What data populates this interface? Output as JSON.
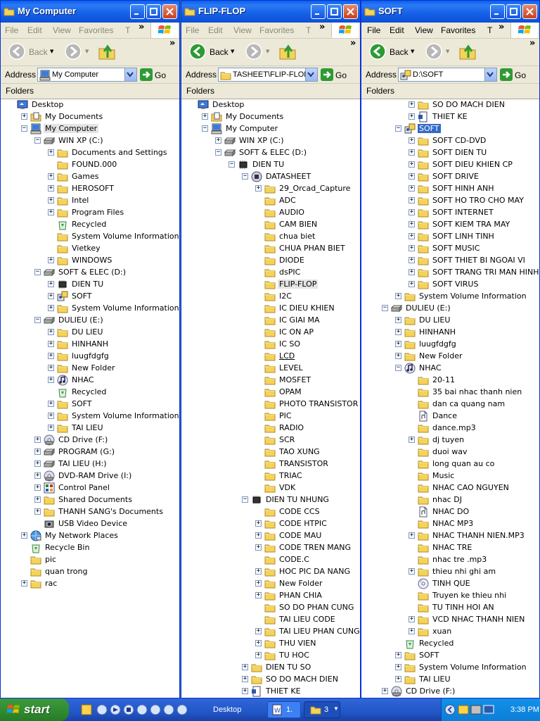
{
  "colors": {
    "title_blue": "#0a5fea",
    "selection": "#316ac5",
    "folder_yellow": "#f4d35a",
    "start_green": "#2f8a2f"
  },
  "menu": {
    "file": "File",
    "edit": "Edit",
    "view": "View",
    "favorites": "Favorites",
    "tools": "T"
  },
  "toolbar": {
    "back": "Back"
  },
  "address_label": "Address",
  "go_label": "Go",
  "folders_label": "Folders",
  "windows": [
    {
      "title": "My Computer",
      "address": "My Computer",
      "address_icon": "computer-icon",
      "menu_dim": true,
      "tree": [
        {
          "i": 0,
          "e": "",
          "ic": "desktop",
          "t": "Desktop"
        },
        {
          "i": 1,
          "e": "+",
          "ic": "mydocs",
          "t": "My Documents"
        },
        {
          "i": 1,
          "e": "-",
          "ic": "computer",
          "t": "My Computer",
          "s": "hl"
        },
        {
          "i": 2,
          "e": "-",
          "ic": "drive",
          "t": "WIN XP (C:)"
        },
        {
          "i": 3,
          "e": "+",
          "ic": "folder",
          "t": "Documents and Settings"
        },
        {
          "i": 3,
          "e": "",
          "ic": "folder",
          "t": "FOUND.000"
        },
        {
          "i": 3,
          "e": "+",
          "ic": "folder",
          "t": "Games"
        },
        {
          "i": 3,
          "e": "+",
          "ic": "folder",
          "t": "HEROSOFT"
        },
        {
          "i": 3,
          "e": "+",
          "ic": "folder",
          "t": "Intel"
        },
        {
          "i": 3,
          "e": "+",
          "ic": "folder",
          "t": "Program Files"
        },
        {
          "i": 3,
          "e": "",
          "ic": "recycle",
          "t": "Recycled"
        },
        {
          "i": 3,
          "e": "",
          "ic": "folder",
          "t": "System Volume Information"
        },
        {
          "i": 3,
          "e": "",
          "ic": "folder",
          "t": "Vietkey"
        },
        {
          "i": 3,
          "e": "+",
          "ic": "folder",
          "t": "WINDOWS"
        },
        {
          "i": 2,
          "e": "-",
          "ic": "drive",
          "t": "SOFT & ELEC (D:)"
        },
        {
          "i": 3,
          "e": "+",
          "ic": "chip",
          "t": "DIEN TU"
        },
        {
          "i": 3,
          "e": "+",
          "ic": "soft",
          "t": "SOFT"
        },
        {
          "i": 3,
          "e": "+",
          "ic": "folder",
          "t": "System Volume Information"
        },
        {
          "i": 2,
          "e": "-",
          "ic": "drive",
          "t": "DULIEU (E:)"
        },
        {
          "i": 3,
          "e": "+",
          "ic": "folder",
          "t": "DU LIEU"
        },
        {
          "i": 3,
          "e": "+",
          "ic": "folder",
          "t": "HINHANH"
        },
        {
          "i": 3,
          "e": "+",
          "ic": "folder",
          "t": "luugfdgfg"
        },
        {
          "i": 3,
          "e": "+",
          "ic": "folder",
          "t": "New Folder"
        },
        {
          "i": 3,
          "e": "+",
          "ic": "music",
          "t": "NHAC"
        },
        {
          "i": 3,
          "e": "",
          "ic": "recycle",
          "t": "Recycled"
        },
        {
          "i": 3,
          "e": "+",
          "ic": "folder",
          "t": "SOFT"
        },
        {
          "i": 3,
          "e": "+",
          "ic": "folder",
          "t": "System Volume Information"
        },
        {
          "i": 3,
          "e": "+",
          "ic": "folder",
          "t": "TAI LIEU"
        },
        {
          "i": 2,
          "e": "+",
          "ic": "cd",
          "t": "CD Drive (F:)"
        },
        {
          "i": 2,
          "e": "+",
          "ic": "drive",
          "t": "PROGRAM (G:)"
        },
        {
          "i": 2,
          "e": "+",
          "ic": "drive",
          "t": "TAI LIEU (H:)"
        },
        {
          "i": 2,
          "e": "+",
          "ic": "cd",
          "t": "DVD-RAM Drive (I:)"
        },
        {
          "i": 2,
          "e": "+",
          "ic": "control",
          "t": "Control Panel"
        },
        {
          "i": 2,
          "e": "+",
          "ic": "folder",
          "t": "Shared Documents"
        },
        {
          "i": 2,
          "e": "+",
          "ic": "folder",
          "t": "THANH SANG's Documents"
        },
        {
          "i": 2,
          "e": "",
          "ic": "camera",
          "t": "USB Video Device"
        },
        {
          "i": 1,
          "e": "+",
          "ic": "network",
          "t": "My Network Places"
        },
        {
          "i": 1,
          "e": "",
          "ic": "recycle",
          "t": "Recycle Bin"
        },
        {
          "i": 1,
          "e": "",
          "ic": "folder",
          "t": "pic"
        },
        {
          "i": 1,
          "e": "",
          "ic": "folder",
          "t": "quan trong"
        },
        {
          "i": 1,
          "e": "+",
          "ic": "folder",
          "t": "rac"
        }
      ]
    },
    {
      "title": "FLIP-FLOP",
      "address": "TASHEET\\FLIP-FLOP",
      "address_icon": "folder-icon",
      "menu_dim": true,
      "tree": [
        {
          "i": 0,
          "e": "",
          "ic": "desktop",
          "t": "Desktop"
        },
        {
          "i": 1,
          "e": "+",
          "ic": "mydocs",
          "t": "My Documents"
        },
        {
          "i": 1,
          "e": "-",
          "ic": "computer",
          "t": "My Computer"
        },
        {
          "i": 2,
          "e": "+",
          "ic": "drive",
          "t": "WIN XP (C:)"
        },
        {
          "i": 2,
          "e": "-",
          "ic": "drive",
          "t": "SOFT & ELEC (D:)"
        },
        {
          "i": 3,
          "e": "-",
          "ic": "chip",
          "t": "DIEN TU"
        },
        {
          "i": 4,
          "e": "-",
          "ic": "chip2",
          "t": "DATASHEET"
        },
        {
          "i": 5,
          "e": "+",
          "ic": "folder",
          "t": "29_Orcad_Capture"
        },
        {
          "i": 5,
          "e": "",
          "ic": "folder",
          "t": "ADC"
        },
        {
          "i": 5,
          "e": "",
          "ic": "folder",
          "t": "AUDIO"
        },
        {
          "i": 5,
          "e": "",
          "ic": "folder",
          "t": "CAM BIEN"
        },
        {
          "i": 5,
          "e": "",
          "ic": "folder",
          "t": "chua biet"
        },
        {
          "i": 5,
          "e": "",
          "ic": "folder",
          "t": "CHUA PHAN BIET"
        },
        {
          "i": 5,
          "e": "",
          "ic": "folder",
          "t": "DIODE"
        },
        {
          "i": 5,
          "e": "",
          "ic": "folder",
          "t": "dsPIC"
        },
        {
          "i": 5,
          "e": "",
          "ic": "folder",
          "t": "FLIP-FLOP",
          "s": "hl"
        },
        {
          "i": 5,
          "e": "",
          "ic": "folder",
          "t": "I2C"
        },
        {
          "i": 5,
          "e": "",
          "ic": "folder",
          "t": "IC DIEU KHIEN"
        },
        {
          "i": 5,
          "e": "",
          "ic": "folder",
          "t": "IC GIAI MA"
        },
        {
          "i": 5,
          "e": "",
          "ic": "folder",
          "t": "IC ON AP"
        },
        {
          "i": 5,
          "e": "",
          "ic": "folder",
          "t": "IC SO"
        },
        {
          "i": 5,
          "e": "",
          "ic": "folder",
          "t": "LCD",
          "s": "ul"
        },
        {
          "i": 5,
          "e": "",
          "ic": "folder",
          "t": "LEVEL"
        },
        {
          "i": 5,
          "e": "",
          "ic": "folder",
          "t": "MOSFET"
        },
        {
          "i": 5,
          "e": "",
          "ic": "folder",
          "t": "OPAM"
        },
        {
          "i": 5,
          "e": "",
          "ic": "folder",
          "t": "PHOTO TRANSISTOR"
        },
        {
          "i": 5,
          "e": "",
          "ic": "folder",
          "t": "PIC"
        },
        {
          "i": 5,
          "e": "",
          "ic": "folder",
          "t": "RADIO"
        },
        {
          "i": 5,
          "e": "",
          "ic": "folder",
          "t": "SCR"
        },
        {
          "i": 5,
          "e": "",
          "ic": "folder",
          "t": "TAO XUNG"
        },
        {
          "i": 5,
          "e": "",
          "ic": "folder",
          "t": "TRANSISTOR"
        },
        {
          "i": 5,
          "e": "",
          "ic": "folder",
          "t": "TRIAC"
        },
        {
          "i": 5,
          "e": "",
          "ic": "folder",
          "t": "VDK"
        },
        {
          "i": 4,
          "e": "-",
          "ic": "chip",
          "t": "DIEN TU NHUNG"
        },
        {
          "i": 5,
          "e": "",
          "ic": "folder",
          "t": "CODE CCS"
        },
        {
          "i": 5,
          "e": "+",
          "ic": "folder",
          "t": "CODE HTPIC"
        },
        {
          "i": 5,
          "e": "+",
          "ic": "folder",
          "t": "CODE MAU"
        },
        {
          "i": 5,
          "e": "+",
          "ic": "folder",
          "t": "CODE TREN MANG"
        },
        {
          "i": 5,
          "e": "",
          "ic": "folder",
          "t": "CODE.C"
        },
        {
          "i": 5,
          "e": "+",
          "ic": "folder",
          "t": "HOC PIC DA NANG"
        },
        {
          "i": 5,
          "e": "+",
          "ic": "folder",
          "t": "New Folder"
        },
        {
          "i": 5,
          "e": "+",
          "ic": "folder",
          "t": "PHAN CHIA"
        },
        {
          "i": 5,
          "e": "",
          "ic": "folder",
          "t": "SO DO PHAN CUNG"
        },
        {
          "i": 5,
          "e": "",
          "ic": "folder",
          "t": "TAI LIEU CODE"
        },
        {
          "i": 5,
          "e": "+",
          "ic": "folder",
          "t": "TAI LIEU PHAN CUNG"
        },
        {
          "i": 5,
          "e": "+",
          "ic": "folder",
          "t": "THU VIEN"
        },
        {
          "i": 5,
          "e": "+",
          "ic": "folder",
          "t": "TU HOC"
        },
        {
          "i": 4,
          "e": "+",
          "ic": "folder",
          "t": "DIEN TU SO"
        },
        {
          "i": 4,
          "e": "+",
          "ic": "folder",
          "t": "SO DO MACH DIEN"
        },
        {
          "i": 4,
          "e": "+",
          "ic": "doc",
          "t": "THIET KE"
        }
      ]
    },
    {
      "title": "SOFT",
      "address": "D:\\SOFT",
      "address_icon": "soft-icon",
      "menu_dim": false,
      "tree": [
        {
          "i": 3,
          "e": "+",
          "ic": "folder",
          "t": "SO DO MACH DIEN"
        },
        {
          "i": 3,
          "e": "+",
          "ic": "doc",
          "t": "THIET KE"
        },
        {
          "i": 2,
          "e": "-",
          "ic": "soft",
          "t": "SOFT",
          "s": "sel"
        },
        {
          "i": 3,
          "e": "+",
          "ic": "folder",
          "t": "SOFT CD-DVD"
        },
        {
          "i": 3,
          "e": "+",
          "ic": "folder",
          "t": "SOFT DIEN TU"
        },
        {
          "i": 3,
          "e": "+",
          "ic": "folder",
          "t": "SOFT DIEU KHIEN CP"
        },
        {
          "i": 3,
          "e": "+",
          "ic": "folder",
          "t": "SOFT DRIVE"
        },
        {
          "i": 3,
          "e": "+",
          "ic": "folder",
          "t": "SOFT HINH ANH"
        },
        {
          "i": 3,
          "e": "+",
          "ic": "folder",
          "t": "SOFT HO TRO CHO MAY"
        },
        {
          "i": 3,
          "e": "+",
          "ic": "folder",
          "t": "SOFT INTERNET"
        },
        {
          "i": 3,
          "e": "+",
          "ic": "folder",
          "t": "SOFT KIEM TRA MAY"
        },
        {
          "i": 3,
          "e": "+",
          "ic": "folder",
          "t": "SOFT LINH TINH"
        },
        {
          "i": 3,
          "e": "+",
          "ic": "folder",
          "t": "SOFT MUSIC"
        },
        {
          "i": 3,
          "e": "+",
          "ic": "folder",
          "t": "SOFT THIET BI NGOAI VI"
        },
        {
          "i": 3,
          "e": "+",
          "ic": "folder",
          "t": "SOFT TRANG TRI MAN HINH"
        },
        {
          "i": 3,
          "e": "+",
          "ic": "folder",
          "t": "SOFT VIRUS"
        },
        {
          "i": 2,
          "e": "+",
          "ic": "folder",
          "t": "System Volume Information"
        },
        {
          "i": 1,
          "e": "-",
          "ic": "drive",
          "t": "DULIEU (E:)"
        },
        {
          "i": 2,
          "e": "+",
          "ic": "folder",
          "t": "DU LIEU"
        },
        {
          "i": 2,
          "e": "+",
          "ic": "folder",
          "t": "HINHANH"
        },
        {
          "i": 2,
          "e": "+",
          "ic": "folder",
          "t": "luugfdgfg"
        },
        {
          "i": 2,
          "e": "+",
          "ic": "folder",
          "t": "New Folder"
        },
        {
          "i": 2,
          "e": "-",
          "ic": "music",
          "t": "NHAC"
        },
        {
          "i": 3,
          "e": "",
          "ic": "folder",
          "t": "20-11"
        },
        {
          "i": 3,
          "e": "",
          "ic": "folder",
          "t": "35 bai nhac thanh nien"
        },
        {
          "i": 3,
          "e": "",
          "ic": "folder",
          "t": "dan ca quang nam"
        },
        {
          "i": 3,
          "e": "",
          "ic": "file",
          "t": "Dance"
        },
        {
          "i": 3,
          "e": "",
          "ic": "folder",
          "t": "dance.mp3"
        },
        {
          "i": 3,
          "e": "+",
          "ic": "folder",
          "t": "dj tuyen"
        },
        {
          "i": 3,
          "e": "",
          "ic": "folder",
          "t": "duoi wav"
        },
        {
          "i": 3,
          "e": "",
          "ic": "folder",
          "t": "long quan au co"
        },
        {
          "i": 3,
          "e": "",
          "ic": "folder",
          "t": "Music"
        },
        {
          "i": 3,
          "e": "",
          "ic": "folder",
          "t": "NHAC CAO NGUYEN"
        },
        {
          "i": 3,
          "e": "",
          "ic": "folder",
          "t": "nhac DJ"
        },
        {
          "i": 3,
          "e": "",
          "ic": "file",
          "t": "NHAC DO"
        },
        {
          "i": 3,
          "e": "",
          "ic": "folder",
          "t": "NHAC MP3"
        },
        {
          "i": 3,
          "e": "+",
          "ic": "folder",
          "t": "NHAC THANH NIEN.MP3"
        },
        {
          "i": 3,
          "e": "",
          "ic": "folder",
          "t": "NHAC TRE"
        },
        {
          "i": 3,
          "e": "",
          "ic": "folder",
          "t": "nhac tre .mp3"
        },
        {
          "i": 3,
          "e": "+",
          "ic": "folder",
          "t": "thieu nhi ghi am"
        },
        {
          "i": 3,
          "e": "",
          "ic": "disc",
          "t": "TINH QUE"
        },
        {
          "i": 3,
          "e": "",
          "ic": "folder",
          "t": "Truyen ke thieu nhi"
        },
        {
          "i": 3,
          "e": "",
          "ic": "folder",
          "t": "TU TINH HOI AN"
        },
        {
          "i": 3,
          "e": "+",
          "ic": "folder",
          "t": "VCD NHAC THANH NIEN"
        },
        {
          "i": 3,
          "e": "+",
          "ic": "folder",
          "t": "xuan"
        },
        {
          "i": 2,
          "e": "",
          "ic": "recycle",
          "t": "Recycled"
        },
        {
          "i": 2,
          "e": "+",
          "ic": "folder",
          "t": "SOFT"
        },
        {
          "i": 2,
          "e": "+",
          "ic": "folder",
          "t": "System Volume Information"
        },
        {
          "i": 2,
          "e": "+",
          "ic": "folder",
          "t": "TAI LIEU"
        },
        {
          "i": 1,
          "e": "+",
          "ic": "cd",
          "t": "CD Drive (F:)"
        }
      ]
    }
  ],
  "taskbar": {
    "start": "start",
    "desktop": "Desktop",
    "task1": "1.",
    "task2": "3",
    "clock": "3:38 PM"
  }
}
